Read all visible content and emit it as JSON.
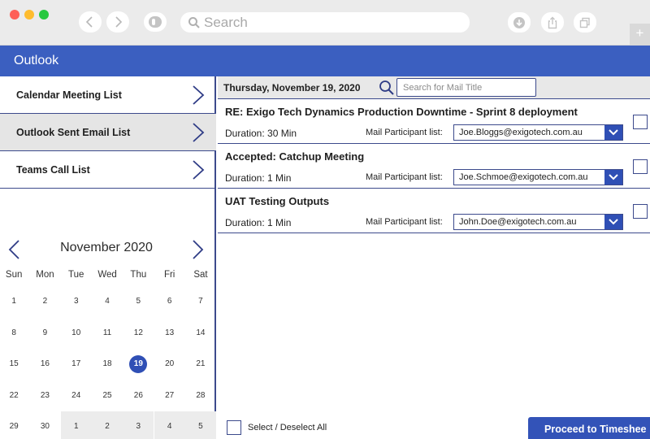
{
  "browser": {
    "search_placeholder": "Search",
    "icons": [
      "back-icon",
      "forward-icon",
      "reader-icon",
      "search-icon",
      "download-icon",
      "share-icon",
      "tabs-icon",
      "new-tab-icon"
    ]
  },
  "app": {
    "title": "Outlook",
    "accent": "#3b5fc0",
    "border": "#3c4a8c"
  },
  "menu": [
    {
      "label": "Calendar Meeting List"
    },
    {
      "label": "Outlook Sent Email List"
    },
    {
      "label": "Teams Call List"
    }
  ],
  "calendar": {
    "month_label": "November 2020",
    "weekdays": [
      "Sun",
      "Mon",
      "Tue",
      "Wed",
      "Thu",
      "Fri",
      "Sat"
    ],
    "weeks": [
      [
        "1",
        "2",
        "3",
        "4",
        "5",
        "6",
        "7"
      ],
      [
        "8",
        "9",
        "10",
        "11",
        "12",
        "13",
        "14"
      ],
      [
        "15",
        "16",
        "17",
        "18",
        "19",
        "20",
        "21"
      ],
      [
        "22",
        "23",
        "24",
        "25",
        "26",
        "27",
        "28"
      ],
      [
        "29",
        "30",
        "1",
        "2",
        "3",
        "4",
        "5"
      ]
    ],
    "selected_day": "19"
  },
  "toolbar": {
    "date": "Thursday, November 19, 2020",
    "search_placeholder": "Search for Mail Title"
  },
  "mails": [
    {
      "subject": "RE: Exigo Tech Dynamics Production Downtime - Sprint 8 deployment",
      "duration": "Duration: 30 Min",
      "participant_label": "Mail Participant list:",
      "participant": "Joe.Bloggs@exigotech.com.au"
    },
    {
      "subject": "Accepted: Catchup Meeting",
      "duration": "Duration: 1 Min",
      "participant_label": "Mail Participant list:",
      "participant": "Joe.Schmoe@exigotech.com.au"
    },
    {
      "subject": "UAT Testing Outputs",
      "duration": "Duration: 1 Min",
      "participant_label": "Mail Participant list:",
      "participant": "John.Doe@exigotech.com.au"
    }
  ],
  "footer": {
    "select_all_label": "Select / Deselect All",
    "proceed_label": "Proceed to Timeshee"
  }
}
